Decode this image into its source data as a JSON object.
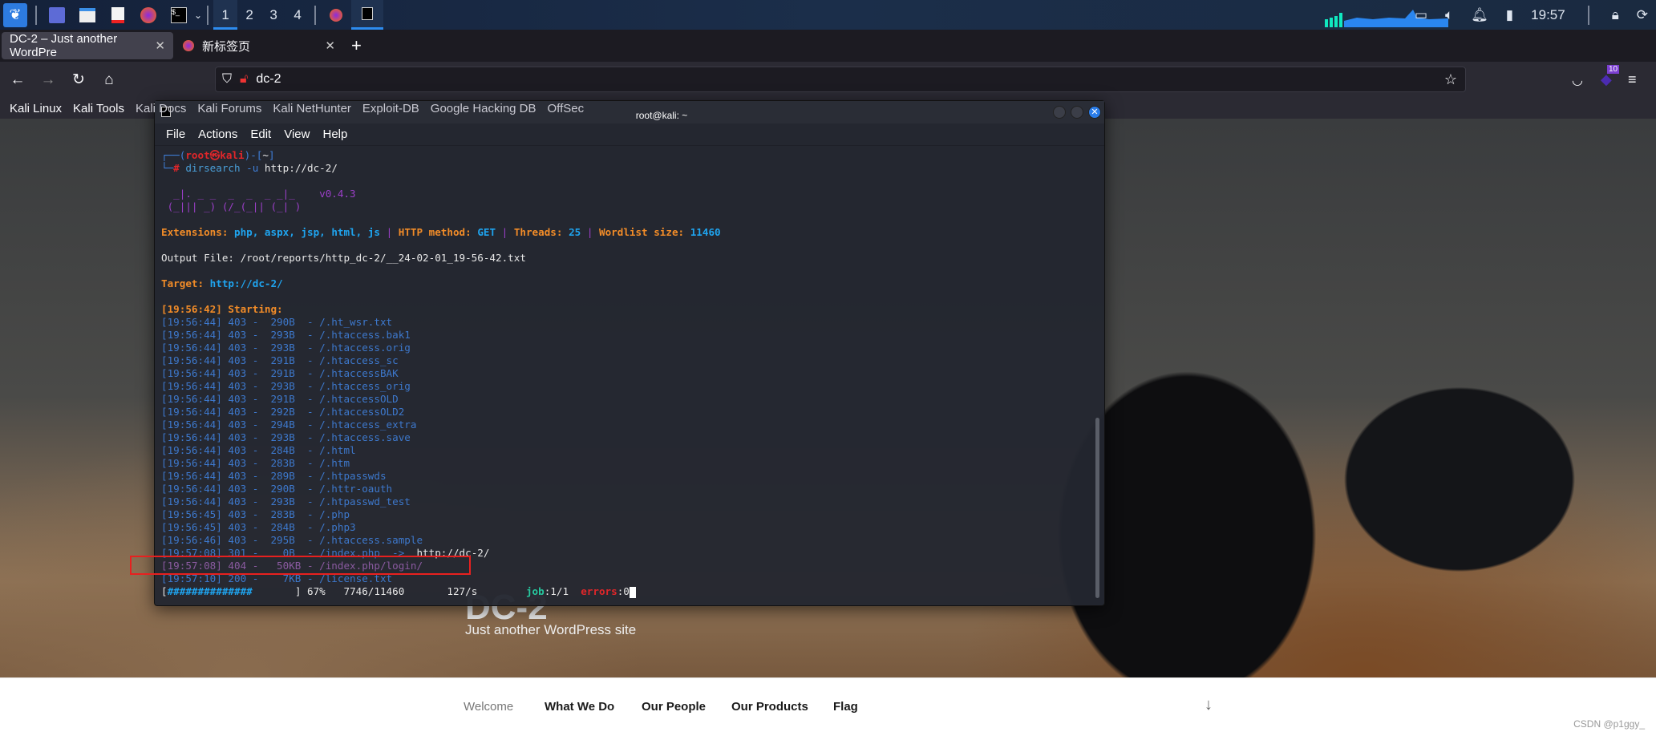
{
  "taskbar": {
    "workspaces": [
      "1",
      "2",
      "3",
      "4"
    ],
    "clock": "19:57",
    "icons": [
      "kali-menu-icon",
      "desktop-icon",
      "file-manager-icon",
      "text-editor-icon",
      "firefox-icon",
      "terminal-icon"
    ]
  },
  "browser": {
    "tabs": [
      {
        "label": "DC-2 – Just another WordPre",
        "active": true
      },
      {
        "label": "新标签页",
        "active": false
      }
    ],
    "url": "dc-2",
    "extension_badge": "10",
    "bookmarks": [
      "Kali Linux",
      "Kali Tools",
      "Kali Docs",
      "Kali Forums",
      "Kali NetHunter",
      "Exploit-DB",
      "Google Hacking DB",
      "OffSec"
    ]
  },
  "site": {
    "title": "DC-2",
    "subtitle": "Just another WordPress site",
    "nav": [
      "Welcome",
      "What We Do",
      "Our People",
      "Our Products",
      "Flag"
    ],
    "watermark": "CSDN @p1ggy_"
  },
  "terminal": {
    "title": "root@kali: ~",
    "menu": [
      "File",
      "Actions",
      "Edit",
      "View",
      "Help"
    ],
    "lines": [
      [
        [
          "c-blue",
          "┌──("
        ],
        [
          "c-red",
          "root㉿kali"
        ],
        [
          "c-blue",
          ")-["
        ],
        [
          "c-white",
          "~"
        ],
        [
          "c-blue",
          "]"
        ]
      ],
      [
        [
          "c-blue",
          "└─"
        ],
        [
          "c-red",
          "#"
        ],
        [
          "c-cyan",
          " dirsearch"
        ],
        [
          "c-blue",
          " -u"
        ],
        [
          "c-white",
          " http://dc-2/"
        ]
      ],
      [],
      [
        [
          "c-purple",
          "  _|. _ _  _  _  _ _|_    "
        ],
        [
          "c-purple",
          "v0.4.3"
        ]
      ],
      [
        [
          "c-purple",
          " (_||| _) (/_(_|| (_| )"
        ]
      ],
      [],
      [
        [
          "c-orange",
          "Extensions: "
        ],
        [
          "c-lblue",
          "php, aspx, jsp, html, js"
        ],
        [
          "c-sep",
          " | "
        ],
        [
          "c-orange",
          "HTTP method: "
        ],
        [
          "c-lblue",
          "GET"
        ],
        [
          "c-sep",
          " | "
        ],
        [
          "c-orange",
          "Threads: "
        ],
        [
          "c-lblue",
          "25"
        ],
        [
          "c-sep",
          " | "
        ],
        [
          "c-orange",
          "Wordlist size: "
        ],
        [
          "c-lblue",
          "11460"
        ]
      ],
      [],
      [
        [
          "c-white",
          "Output File: /root/reports/http_dc-2/__24-02-01_19-56-42.txt"
        ]
      ],
      [],
      [
        [
          "c-orange",
          "Target: "
        ],
        [
          "c-lblue",
          "http://dc-2/"
        ]
      ],
      [],
      [
        [
          "c-orange",
          "[19:56:42] Starting: "
        ]
      ],
      [
        [
          "c-log",
          "[19:56:44] 403 -  290B  - /.ht_wsr.txt"
        ]
      ],
      [
        [
          "c-log",
          "[19:56:44] 403 -  293B  - /.htaccess.bak1"
        ]
      ],
      [
        [
          "c-log",
          "[19:56:44] 403 -  293B  - /.htaccess.orig"
        ]
      ],
      [
        [
          "c-log",
          "[19:56:44] 403 -  291B  - /.htaccess_sc"
        ]
      ],
      [
        [
          "c-log",
          "[19:56:44] 403 -  291B  - /.htaccessBAK"
        ]
      ],
      [
        [
          "c-log",
          "[19:56:44] 403 -  293B  - /.htaccess_orig"
        ]
      ],
      [
        [
          "c-log",
          "[19:56:44] 403 -  291B  - /.htaccessOLD"
        ]
      ],
      [
        [
          "c-log",
          "[19:56:44] 403 -  292B  - /.htaccessOLD2"
        ]
      ],
      [
        [
          "c-log",
          "[19:56:44] 403 -  294B  - /.htaccess_extra"
        ]
      ],
      [
        [
          "c-log",
          "[19:56:44] 403 -  293B  - /.htaccess.save"
        ]
      ],
      [
        [
          "c-log",
          "[19:56:44] 403 -  284B  - /.html"
        ]
      ],
      [
        [
          "c-log",
          "[19:56:44] 403 -  283B  - /.htm"
        ]
      ],
      [
        [
          "c-log",
          "[19:56:44] 403 -  289B  - /.htpasswds"
        ]
      ],
      [
        [
          "c-log",
          "[19:56:44] 403 -  290B  - /.httr-oauth"
        ]
      ],
      [
        [
          "c-log",
          "[19:56:44] 403 -  293B  - /.htpasswd_test"
        ]
      ],
      [
        [
          "c-log",
          "[19:56:45] 403 -  283B  - /.php"
        ]
      ],
      [
        [
          "c-log",
          "[19:56:45] 403 -  284B  - /.php3"
        ]
      ],
      [
        [
          "c-log",
          "[19:56:46] 403 -  295B  - /.htaccess.sample"
        ]
      ],
      [
        [
          "c-log",
          "[19:57:08] 301 -    0B  - /index.php  ->  "
        ],
        [
          "c-white",
          "http://dc-2/"
        ]
      ],
      [
        [
          "c-mag",
          "[19:57:08] 404 -   50KB - /index.php/login/"
        ]
      ],
      [
        [
          "c-log",
          "[19:57:10] 200 -    7KB - /license.txt"
        ]
      ],
      [
        [
          "c-white",
          "["
        ],
        [
          "c-lblue",
          "##############"
        ],
        [
          "c-white",
          "       ] 67%   7746/11460       127/s        "
        ],
        [
          "c-green",
          "job"
        ],
        [
          "c-white",
          ":1/1  "
        ],
        [
          "c-red",
          "errors"
        ],
        [
          "c-white",
          ":0"
        ]
      ]
    ],
    "progress_percent": 67
  }
}
